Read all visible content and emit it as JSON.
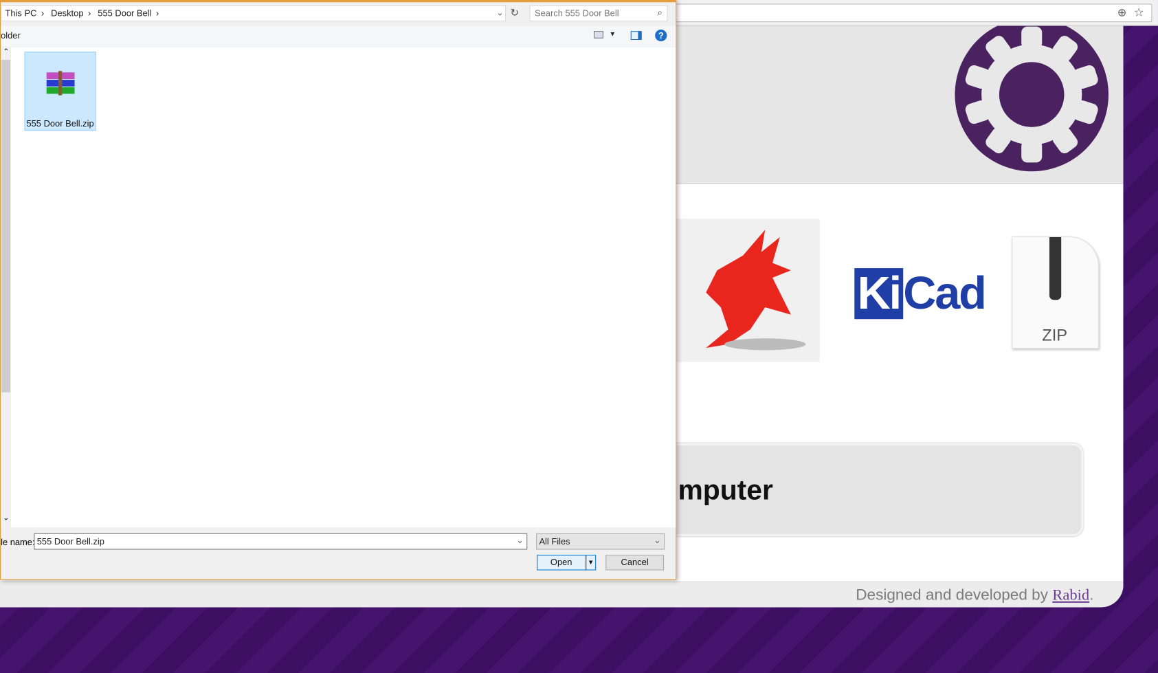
{
  "dialog": {
    "breadcrumb": [
      "This PC",
      "Desktop",
      "555 Door Bell"
    ],
    "search_placeholder": "Search 555 Door Bell",
    "toolbar_label": "older",
    "files": [
      {
        "name": "555 Door Bell.zip",
        "icon": "winrar-archive-icon",
        "selected": true
      }
    ],
    "file_name_label": "le name:",
    "file_name_value": "555 Door Bell.zip",
    "file_type": "All Files",
    "open_label": "Open",
    "cancel_label": "Cancel",
    "accent_color": "#e69c3a"
  },
  "page": {
    "card_text": "mputer",
    "footer_text": "Designed and developed by ",
    "footer_link": "Rabid",
    "footer_end": ".",
    "logos": [
      "cadsoft-eagle-logo",
      "kicad-logo",
      "zip-file-icon"
    ],
    "kicad_text": {
      "ki": "Ki",
      "cad": "Cad"
    },
    "zip_label": "ZIP"
  }
}
